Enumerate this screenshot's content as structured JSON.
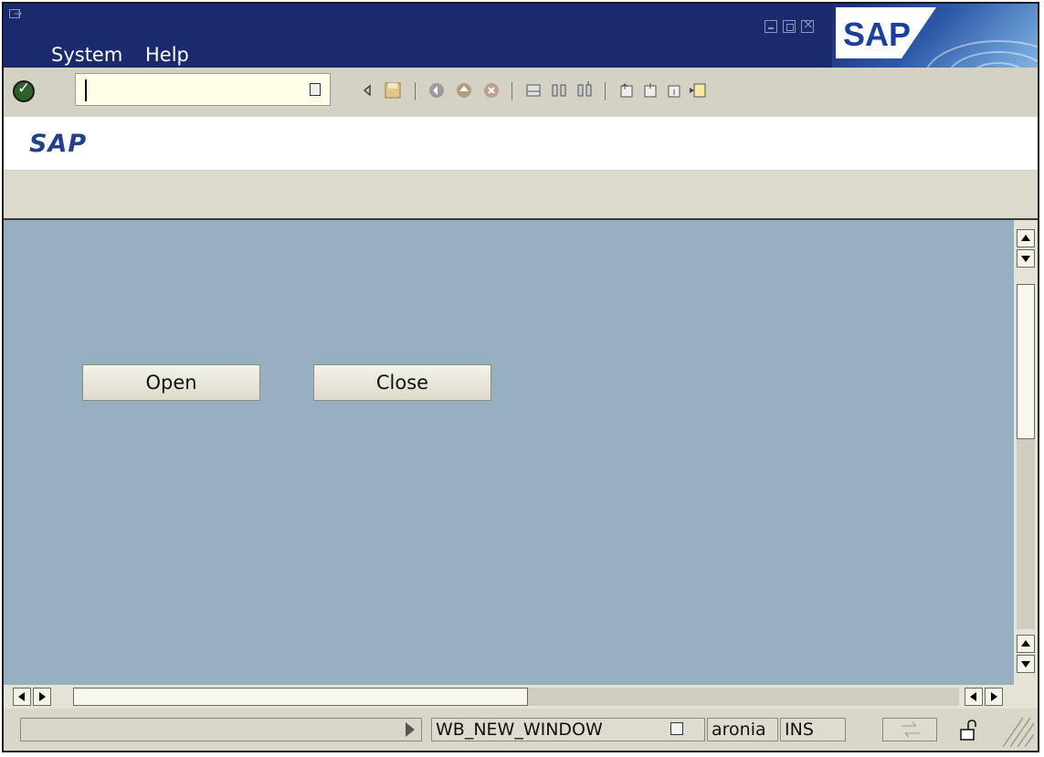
{
  "window": {
    "menu": [
      "System",
      "Help"
    ],
    "controls": [
      "minimize",
      "maximize",
      "close"
    ],
    "brand_logo_text": "SAP"
  },
  "toolbar": {
    "command_field_value": "",
    "icons": [
      "enter-icon",
      "command-history-icon",
      "back-icon",
      "save-icon",
      "back-green-icon",
      "exit-icon",
      "cancel-icon",
      "print-icon",
      "find-icon",
      "find-next-icon",
      "first-page-icon",
      "previous-page-icon",
      "next-page-icon",
      "last-page-icon"
    ]
  },
  "title": "SAP",
  "buttons": {
    "open": "Open",
    "close": "Close"
  },
  "status": {
    "transaction": "WB_NEW_WINDOW",
    "server": "aronia",
    "mode": "INS"
  },
  "colors": {
    "titlebar": "#1b2a6c",
    "screen_bg": "#96b0c2",
    "title_text": "#24408c"
  }
}
